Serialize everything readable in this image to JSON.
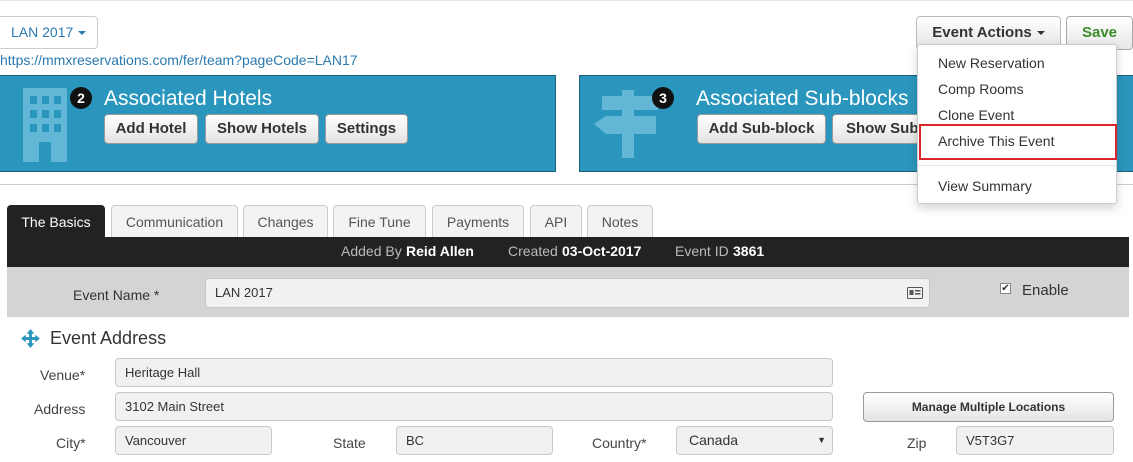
{
  "header": {
    "event_selector": "LAN 2017",
    "page_url": "https://mmxreservations.com/fer/team?pageCode=LAN17",
    "event_actions_label": "Event Actions",
    "save_label": "Save"
  },
  "panels": {
    "hotels": {
      "count": "2",
      "title": "Associated Hotels",
      "buttons": [
        "Add Hotel",
        "Show Hotels",
        "Settings"
      ]
    },
    "subblocks": {
      "count": "3",
      "title": "Associated Sub-blocks",
      "buttons": [
        "Add Sub-block",
        "Show Sub"
      ]
    }
  },
  "event_actions_menu": {
    "items": [
      "New Reservation",
      "Comp Rooms",
      "Clone Event",
      "Archive This Event",
      "View Summary"
    ],
    "highlighted": "Archive This Event"
  },
  "tabs": [
    "The Basics",
    "Communication",
    "Changes",
    "Fine Tune",
    "Payments",
    "API",
    "Notes"
  ],
  "active_tab": "The Basics",
  "info": {
    "added_by_label": "Added By",
    "added_by": "Reid Allen",
    "created_label": "Created",
    "created": "03-Oct-2017",
    "event_id_label": "Event ID",
    "event_id": "3861"
  },
  "event_name": {
    "label": "Event Name *",
    "value": "LAN 2017",
    "enable_label": "Enable",
    "enable_checked": true
  },
  "address": {
    "section_title": "Event Address",
    "venue_label": "Venue*",
    "venue": "Heritage Hall",
    "address_label": "Address",
    "address": "3102 Main Street",
    "manage_label": "Manage Multiple Locations",
    "city_label": "City*",
    "city": "Vancouver",
    "state_label": "State",
    "state": "BC",
    "country_label": "Country*",
    "country": "Canada",
    "zip_label": "Zip",
    "zip": "V5T3G7"
  },
  "colors": {
    "panel_blue": "#2b96bd",
    "link_blue": "#2a7ab0",
    "save_green": "#3c8b2a",
    "highlight_red": "#d9262b",
    "dark_bar": "#222222"
  }
}
